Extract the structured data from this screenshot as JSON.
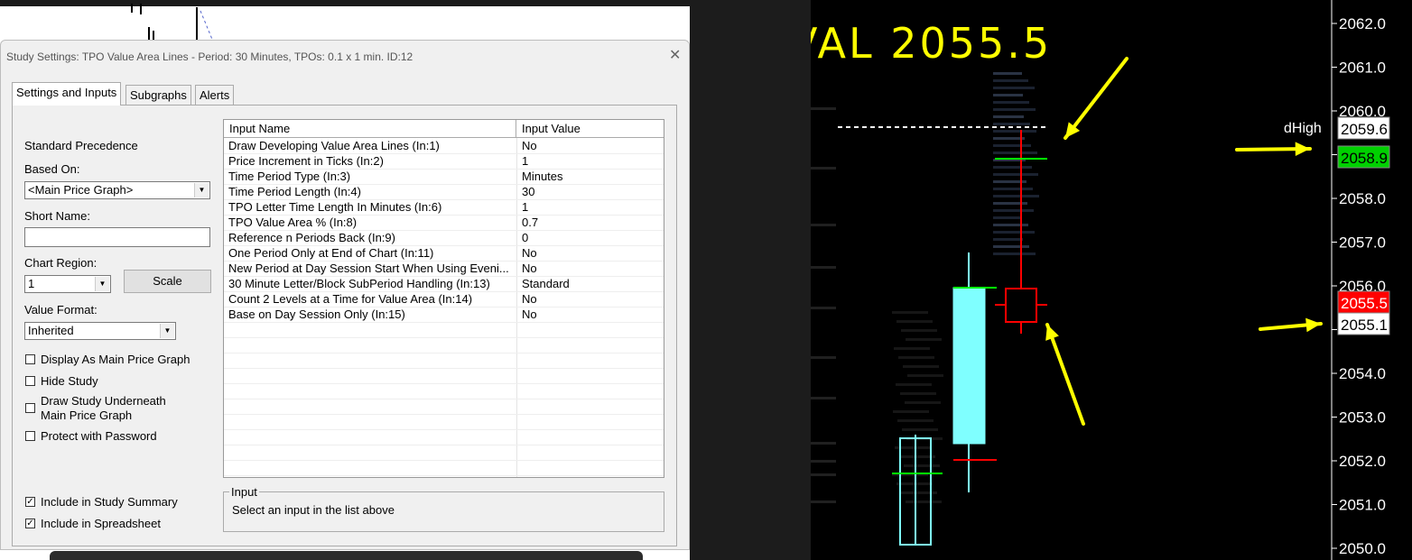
{
  "dialog": {
    "title": "Study Settings: TPO Value Area Lines - Period: 30 Minutes, TPOs: 0.1 x 1 min. ID:12",
    "close_label": "✕",
    "tabs": [
      {
        "label": "Settings and Inputs",
        "active": true
      },
      {
        "label": "Subgraphs",
        "active": false
      },
      {
        "label": "Alerts",
        "active": false
      }
    ]
  },
  "settings": {
    "standard_precedence_label": "Standard Precedence",
    "based_on_label": "Based On:",
    "based_on_value": "<Main Price Graph>",
    "short_name_label": "Short Name:",
    "short_name_value": "",
    "chart_region_label": "Chart Region:",
    "chart_region_value": "1",
    "scale_button": "Scale",
    "value_format_label": "Value Format:",
    "value_format_value": "Inherited",
    "checkboxes": [
      {
        "label": "Display As Main Price Graph",
        "checked": false
      },
      {
        "label": "Hide Study",
        "checked": false
      },
      {
        "label": "Draw Study Underneath",
        "label2": "Main Price Graph",
        "checked": false
      },
      {
        "label": "Protect with Password",
        "checked": false
      },
      {
        "label": "Include in Study Summary",
        "checked": true
      },
      {
        "label": "Include in Spreadsheet",
        "checked": true
      }
    ]
  },
  "inputs_table": {
    "columns": [
      "Input Name",
      "Input Value"
    ],
    "rows": [
      {
        "name": "Draw Developing Value Area Lines  (In:1)",
        "value": "No"
      },
      {
        "name": "Price Increment in Ticks  (In:2)",
        "value": "1"
      },
      {
        "name": "Time Period Type  (In:3)",
        "value": "Minutes"
      },
      {
        "name": "Time Period Length  (In:4)",
        "value": "30"
      },
      {
        "name": "TPO Letter Time Length In Minutes  (In:6)",
        "value": "1"
      },
      {
        "name": "TPO Value Area %  (In:8)",
        "value": "0.7"
      },
      {
        "name": "Reference n Periods Back  (In:9)",
        "value": "0"
      },
      {
        "name": "One Period Only at End of Chart  (In:11)",
        "value": "No"
      },
      {
        "name": "New Period at Day Session Start When Using Eveni...",
        "value": "No"
      },
      {
        "name": "30 Minute Letter/Block SubPeriod Handling  (In:13)",
        "value": "Standard"
      },
      {
        "name": "Count 2 Levels at a Time for Value Area  (In:14)",
        "value": "No"
      },
      {
        "name": "Base on Day Session Only  (In:15)",
        "value": "No"
      }
    ]
  },
  "input_group": {
    "title": "Input",
    "help_text": "Select an input in the list above"
  },
  "chart": {
    "annotation": "VAL 2055.5",
    "price_labels": [
      "2062.0",
      "2061.0",
      "2060.0",
      "2059.0",
      "2058.0",
      "2057.0",
      "2056.0",
      "2055.0",
      "2054.0",
      "2053.0",
      "2052.0",
      "2051.0",
      "2050.0"
    ],
    "marker_label": "dHigh",
    "badges": [
      {
        "text": "2059.6",
        "bg": "#ffffff",
        "fg": "#000000"
      },
      {
        "text": "2058.9",
        "bg": "#00d000",
        "fg": "#000000"
      },
      {
        "text": "2055.5",
        "bg": "#ff0000",
        "fg": "#ffffff"
      },
      {
        "text": "2055.1",
        "bg": "#ffffff",
        "fg": "#000000"
      }
    ],
    "colors": {
      "annotation": "#ffff00",
      "axis_text": "#ffffff",
      "candle_up": "#7fffff",
      "candle_down": "#ff0000",
      "value_line": "#00ff00"
    }
  }
}
